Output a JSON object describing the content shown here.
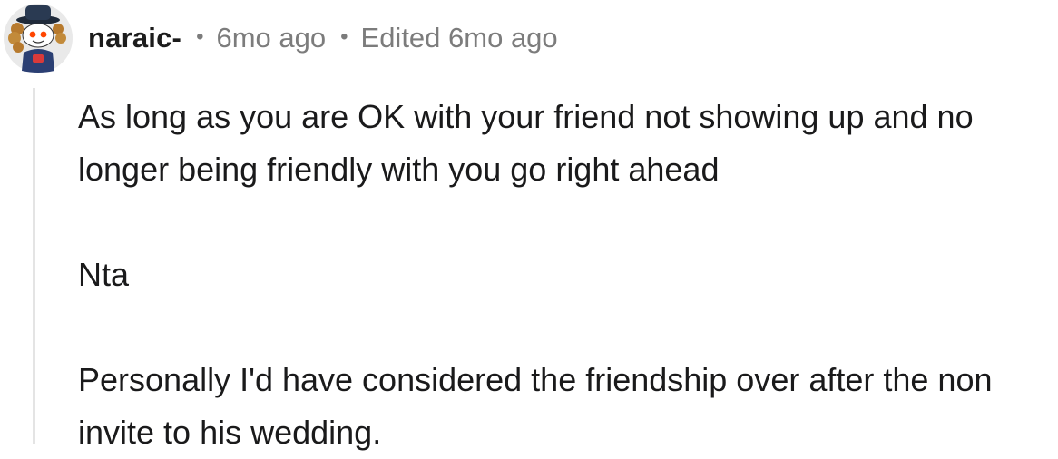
{
  "comment": {
    "author": "naraic-",
    "separator": "•",
    "posted": "6mo ago",
    "edited": "Edited 6mo ago",
    "avatar_icon": "snoo-avatar-icon",
    "paragraphs": [
      "As long as you are OK with your friend not showing up and no longer being friendly with you go right ahead",
      "Nta",
      "Personally I'd have considered the friendship over after the non invite to his wedding."
    ]
  },
  "colors": {
    "text": "#1a1a1b",
    "muted": "#7c7c7c",
    "thread_line": "#e4e4e4"
  }
}
